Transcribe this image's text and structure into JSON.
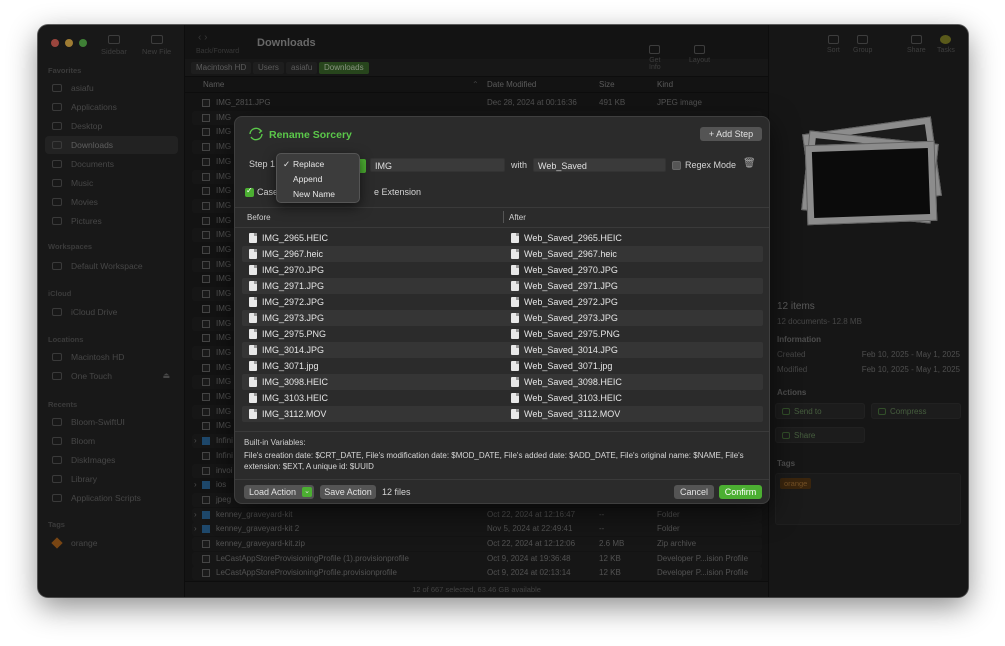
{
  "window": {
    "toolbar_left": {
      "sidebar_label": "Sidebar",
      "new_file_label": "New File",
      "nav_label": "Back/Forward"
    },
    "title": "Downloads",
    "toolbar_right": {
      "get_info": "Get Info",
      "layout": "Layout",
      "sort": "Sort",
      "group": "Group",
      "share": "Share",
      "tasks": "Tasks"
    }
  },
  "sidebar": {
    "favorites_title": "Favorites",
    "favorites": [
      "asiafu",
      "Applications",
      "Desktop",
      "Downloads",
      "Documents",
      "Music",
      "Movies",
      "Pictures"
    ],
    "workspaces_title": "Workspaces",
    "workspaces": [
      "Default Workspace"
    ],
    "icloud_title": "iCloud",
    "icloud": [
      "iCloud Drive"
    ],
    "locations_title": "Locations",
    "locations": [
      "Macintosh HD",
      "One Touch"
    ],
    "recents_title": "Recents",
    "recents": [
      "Bloom-SwiftUI",
      "Bloom",
      "DiskImages",
      "Library",
      "Application Scripts"
    ],
    "tags_title": "Tags",
    "tags": [
      "orange"
    ]
  },
  "path": [
    "Macintosh HD",
    "Users",
    "asiafu",
    "Downloads"
  ],
  "columns": {
    "name": "Name",
    "date": "Date Modified",
    "size": "Size",
    "kind": "Kind"
  },
  "files_top": [
    {
      "name": "IMG_2811.JPG",
      "date": "Dec 28, 2024 at 00:16:36",
      "size": "491 KB",
      "kind": "JPEG image"
    }
  ],
  "files_hidden_prefix": [
    "IMG",
    "IMG",
    "IMG",
    "IMG",
    "IMG",
    "IMG",
    "IMG",
    "IMG",
    "IMG",
    "IMG",
    "IMG",
    "IMG",
    "IMG",
    "IMG",
    "IMG",
    "IMG",
    "IMG",
    "IMG",
    "IMG",
    "IMG",
    "IMG",
    "IMG",
    "Infini",
    "Infini",
    "invoi",
    "ios",
    "jpeg"
  ],
  "files_bottom": [
    {
      "name": "kenney_graveyard-kit",
      "date": "Oct 22, 2024 at 12:16:47",
      "size": "--",
      "kind": "Folder",
      "folder": true
    },
    {
      "name": "kenney_graveyard-kit 2",
      "date": "Nov 5, 2024 at 22:49:41",
      "size": "--",
      "kind": "Folder",
      "folder": true
    },
    {
      "name": "kenney_graveyard-kit.zip",
      "date": "Oct 22, 2024 at 12:12:06",
      "size": "2.6 MB",
      "kind": "Zip archive",
      "folder": false
    },
    {
      "name": "LeCastAppStoreProvisioningProfile (1).provisionprofile",
      "date": "Oct 9, 2024 at 19:36:48",
      "size": "12 KB",
      "kind": "Developer P...ision Profile",
      "folder": false
    },
    {
      "name": "LeCastAppStoreProvisioningProfile.provisionprofile",
      "date": "Oct 9, 2024 at 02:13:14",
      "size": "12 KB",
      "kind": "Developer P...ision Profile",
      "folder": false
    }
  ],
  "status": "12 of 667 selected, 63.46 GB available",
  "preview": {
    "count": "12 items",
    "summary": "12 documents- 12.8 MB",
    "info_title": "Information",
    "created_label": "Created",
    "created_value": "Feb 10, 2025 - May 1, 2025",
    "modified_label": "Modified",
    "modified_value": "Feb 10, 2025 - May 1, 2025",
    "actions_title": "Actions",
    "send_to": "Send to",
    "compress": "Compress",
    "share": "Share",
    "tags_title": "Tags",
    "tag": "orange"
  },
  "modal": {
    "title": "Rename Sorcery",
    "add_step": "Add Step",
    "step_label": "Step 1",
    "find_value": "IMG",
    "with_label": "with",
    "replace_value": "Web_Saved",
    "regex_label": "Regex Mode",
    "case_label": "Case",
    "ext_label": "e Extension",
    "before_header": "Before",
    "after_header": "After",
    "rows": [
      {
        "before": "IMG_2965.HEIC",
        "after": "Web_Saved_2965.HEIC"
      },
      {
        "before": "IMG_2967.heic",
        "after": "Web_Saved_2967.heic"
      },
      {
        "before": "IMG_2970.JPG",
        "after": "Web_Saved_2970.JPG"
      },
      {
        "before": "IMG_2971.JPG",
        "after": "Web_Saved_2971.JPG"
      },
      {
        "before": "IMG_2972.JPG",
        "after": "Web_Saved_2972.JPG"
      },
      {
        "before": "IMG_2973.JPG",
        "after": "Web_Saved_2973.JPG"
      },
      {
        "before": "IMG_2975.PNG",
        "after": "Web_Saved_2975.PNG"
      },
      {
        "before": "IMG_3014.JPG",
        "after": "Web_Saved_3014.JPG"
      },
      {
        "before": "IMG_3071.jpg",
        "after": "Web_Saved_3071.jpg"
      },
      {
        "before": "IMG_3098.HEIC",
        "after": "Web_Saved_3098.HEIC"
      },
      {
        "before": "IMG_3103.HEIC",
        "after": "Web_Saved_3103.HEIC"
      },
      {
        "before": "IMG_3112.MOV",
        "after": "Web_Saved_3112.MOV"
      }
    ],
    "vars_title": "Built-in Variables:",
    "vars_text": "File's creation date: $CRT_DATE, File's modification date: $MOD_DATE, File's added date: $ADD_DATE, File's original name: $NAME, File's extension: $EXT, A unique id: $UUID",
    "load_action": "Load Action",
    "save_action": "Save Action",
    "file_count": "12 files",
    "cancel": "Cancel",
    "confirm": "Confirm",
    "dropdown": {
      "selected": "Replace",
      "options": [
        "Replace",
        "Append",
        "New Name"
      ]
    }
  },
  "colors": {
    "accent_green": "#4caf32",
    "folder_blue": "#2f6fa5",
    "tag_orange": "#b86a1e"
  }
}
